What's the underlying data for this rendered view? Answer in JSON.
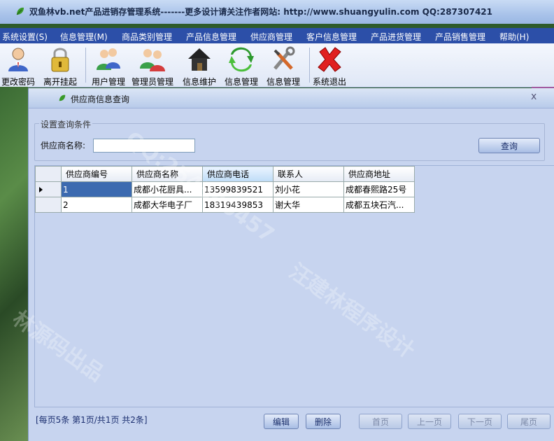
{
  "window": {
    "title": "双鱼林vb.net产品进销存管理系统-------更多设计请关注作者网站: http://www.shuangyulin.com QQ:287307421"
  },
  "menu": [
    "系统设置(S)",
    "信息管理(M)",
    "商品类别管理",
    "产品信息管理",
    "供应商管理",
    "客户信息管理",
    "产品进货管理",
    "产品销售管理",
    "帮助(H)"
  ],
  "toolbar": {
    "items": [
      "更改密码",
      "离开挂起",
      "用户管理",
      "管理员管理",
      "信息维护",
      "信息管理",
      "信息管理",
      "系统退出"
    ]
  },
  "child": {
    "title": "供应商信息查询",
    "close": "x",
    "group": {
      "legend": "设置查询条件",
      "label": "供应商名称:",
      "value": "",
      "query_button": "查询"
    },
    "table": {
      "columns": [
        "供应商编号",
        "供应商名称",
        "供应商电话",
        "联系人",
        "供应商地址"
      ],
      "rows": [
        [
          "1",
          "成都小花厨具...",
          "13599839521",
          "刘小花",
          "成都春熙路25号"
        ],
        [
          "2",
          "成都大华电子厂",
          "18319439853",
          "谢大华",
          "成都五块石汽..."
        ]
      ]
    },
    "status": "[每页5条  第1页/共1页    共2条]",
    "buttons": {
      "edit": "编辑",
      "delete": "删除",
      "first": "首页",
      "prev": "上一页",
      "next": "下一页",
      "last": "尾页"
    }
  },
  "watermarks": [
    "QQ:254540457",
    "汪建林程序设计",
    "林源码出品"
  ]
}
